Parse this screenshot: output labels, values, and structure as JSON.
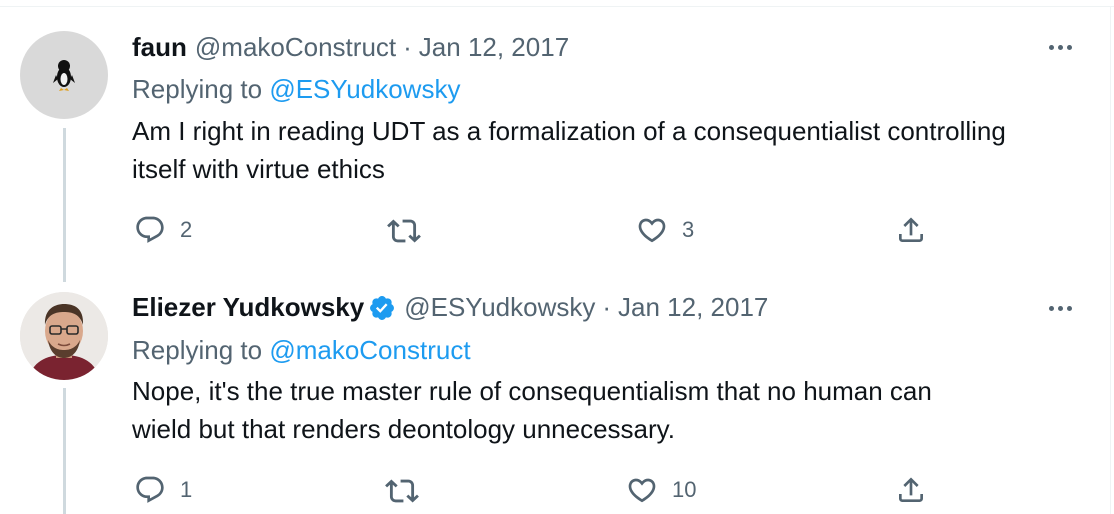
{
  "tweets": [
    {
      "author_name": "faun",
      "handle": "@makoConstruct",
      "separator": "·",
      "date": "Jan 12, 2017",
      "replying_prefix": "Replying to",
      "replying_to": "@ESYudkowsky",
      "text_line1": "Am I right in reading UDT as a formalization of a consequentialist controlling",
      "text_line2": "itself with virtue ethics",
      "reply_count": "2",
      "retweet_count": "",
      "like_count": "3",
      "verified": false
    },
    {
      "author_name": "Eliezer Yudkowsky",
      "handle": "@ESYudkowsky",
      "separator": "·",
      "date": "Jan 12, 2017",
      "replying_prefix": "Replying to",
      "replying_to": "@makoConstruct",
      "text_line1": "Nope, it's the true master rule of consequentialism that no human can",
      "text_line2": "wield but that renders deontology unnecessary.",
      "reply_count": "1",
      "retweet_count": "",
      "like_count": "10",
      "verified": true
    }
  ],
  "colors": {
    "link": "#1d9bf0",
    "muted": "#536471",
    "text": "#0f1419",
    "thread_line": "#cfd9de",
    "verified_badge": "#1d9bf0"
  },
  "icons": [
    "reply-icon",
    "retweet-icon",
    "like-icon",
    "share-icon",
    "more-icon",
    "verified-badge-icon"
  ]
}
